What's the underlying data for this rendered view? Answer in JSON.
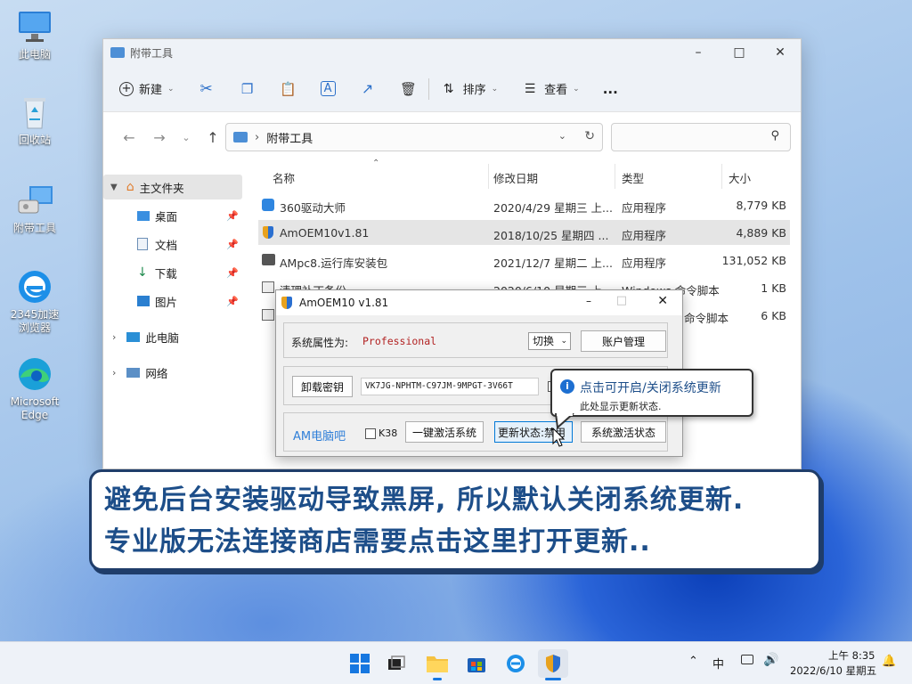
{
  "desktop": {
    "icons": [
      {
        "label": "此电脑",
        "icon": "computer-icon"
      },
      {
        "label": "回收站",
        "icon": "recycle-bin-icon"
      },
      {
        "label": "附带工具",
        "icon": "tools-folder-icon"
      },
      {
        "label": "2345加速浏览器",
        "icon": "browser-2345-icon"
      },
      {
        "label": "Microsoft Edge",
        "icon": "edge-icon"
      }
    ]
  },
  "explorer": {
    "title": "附带工具",
    "toolbar": {
      "new_label": "新建",
      "sort_label": "排序",
      "view_label": "查看",
      "more_label": "..."
    },
    "address": {
      "path": "附带工具"
    },
    "sidebar": {
      "home": "主文件夹",
      "items": [
        "桌面",
        "文档",
        "下载",
        "图片"
      ],
      "this_pc": "此电脑",
      "network": "网络"
    },
    "columns": {
      "name": "名称",
      "date": "修改日期",
      "type": "类型",
      "size": "大小"
    },
    "files": [
      {
        "name": "360驱动大师",
        "date": "2020/4/29 星期三 上...",
        "type": "应用程序",
        "size": "8,779 KB"
      },
      {
        "name": "AmOEM10v1.81",
        "date": "2018/10/25 星期四 ...",
        "type": "应用程序",
        "size": "4,889 KB"
      },
      {
        "name": "AMpc8.运行库安装包",
        "date": "2021/12/7 星期二 上...",
        "type": "应用程序",
        "size": "131,052 KB"
      },
      {
        "name": "清理补丁备份",
        "date": "2020/6/10 星期三 上...",
        "type": "Windows 命令脚本",
        "size": "1 KB"
      },
      {
        "name": "",
        "date": "",
        "type": "命令脚本",
        "size": "6 KB"
      }
    ]
  },
  "dialog": {
    "title": "AmOEM10 v1.81",
    "system_attr_label": "系统属性为:",
    "system_attr_value": "Professional",
    "switch_label": "切换",
    "account_button": "账户管理",
    "uninstall_key_button": "卸载密钥",
    "product_key": "VK7JG-NPHTM-C97JM-9MPGT-3V66T",
    "brand_label": "AM电脑吧",
    "k38_label": "K38",
    "activate_button": "一键激活系统",
    "update_status_button": "更新状态:禁用",
    "activation_status_button": "系统激活状态"
  },
  "tooltip": {
    "title": "点击可开启/关闭系统更新",
    "subtitle": "此处显示更新状态."
  },
  "banner": {
    "line1": "避免后台安装驱动导致黑屏, 所以默认关闭系统更新.",
    "line2": "专业版无法连接商店需要点击这里打开更新.."
  },
  "taskbar": {
    "time": "上午 8:35",
    "date": "2022/6/10 星期五",
    "ime": "中"
  },
  "colors": {
    "accent": "#1d4e89",
    "selected_row": "#e5e5e5",
    "attr_value": "#b22222",
    "brand": "#2f7fd8"
  }
}
